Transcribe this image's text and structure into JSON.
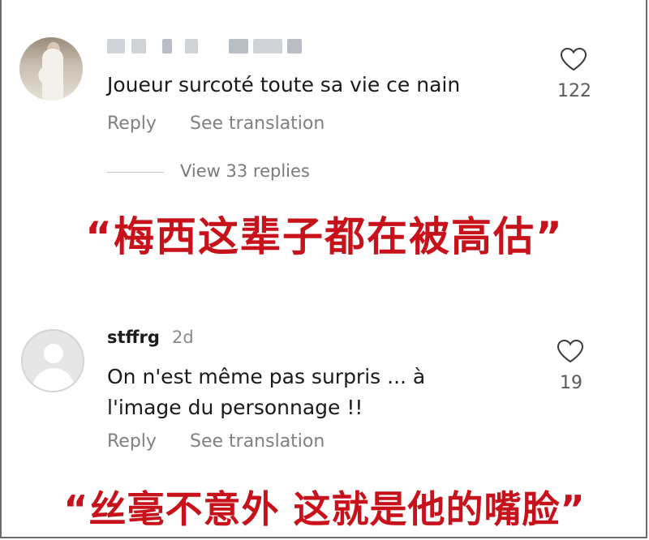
{
  "comments": [
    {
      "username_visible": "",
      "timestamp": "",
      "text": "Joueur surcoté toute sa vie ce nain",
      "reply_label": "Reply",
      "translate_label": "See translation",
      "likes": "122",
      "view_replies": "View 33 replies"
    },
    {
      "username": "stffrg",
      "timestamp": "2d",
      "text": "On n'est même pas surpris ... à\nl'image du personnage !!",
      "reply_label": "Reply",
      "translate_label": "See translation",
      "likes": "19"
    }
  ],
  "captions": [
    "“梅西这辈子都在被高估”",
    "“丝毫不意外 这就是他的嘴脸”"
  ],
  "colors": {
    "caption": "#c8121b",
    "secondary_text": "#808080"
  },
  "icons": {
    "like": "heart-outline-icon",
    "avatar_default": "default-avatar-icon"
  }
}
